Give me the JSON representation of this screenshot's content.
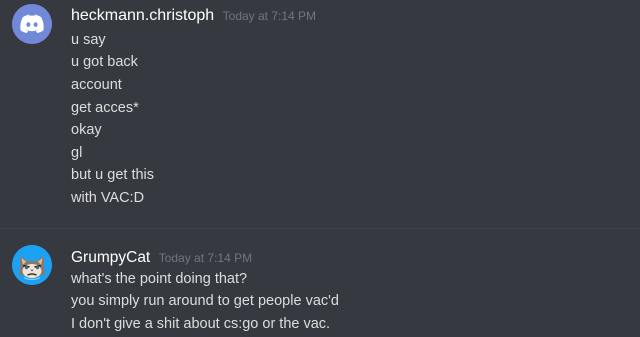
{
  "messages": [
    {
      "username": "heckmann.christoph",
      "timestamp": "Today at 7:14 PM",
      "avatar_icon": "discord-logo-icon",
      "avatar_color": "#7289da",
      "lines": [
        "u say",
        "u got back",
        "account",
        "get acces*",
        "okay",
        "gl",
        "but u get this",
        "with VAC:D"
      ]
    },
    {
      "username": "GrumpyCat",
      "timestamp": "Today at 7:14 PM",
      "avatar_icon": "grumpy-cat-icon",
      "avatar_color": "#1da1f2",
      "lines": [
        "what's the point doing that?",
        "you simply run around to get people vac'd",
        "I don't give a shit about cs:go or the vac."
      ]
    }
  ]
}
